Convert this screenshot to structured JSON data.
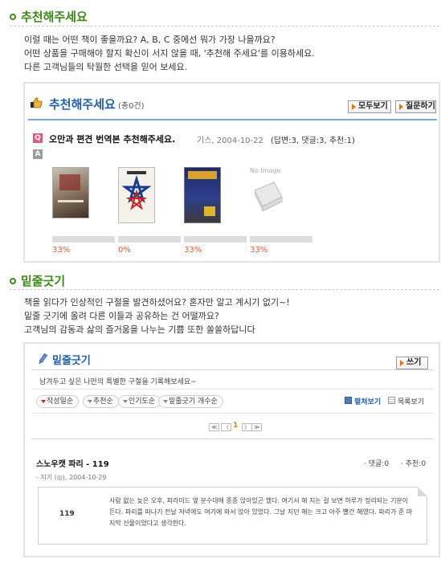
{
  "section1": {
    "title": "추천해주세요",
    "desc": [
      "이럴 때는 어떤 책이 좋을까요? A, B, C 중에선 뭐가 가장 나을까요?",
      "어떤 상품을 구매해야 할지 확신이 서지 않을 때, '추천해 주세요'를 이용하세요.",
      "다른 고객님들의 탁월한 선택을 믿어 보세요."
    ],
    "panel": {
      "title": "추천해주세요",
      "count": "(총0건)",
      "view_all_button": "모두보기",
      "ask_button": "질문하기",
      "q_tag": "Q",
      "a_tag": "A",
      "question_title": "오만과 편견 번역본 추천해주세요.",
      "question_meta": "기스, 2004-10-22",
      "question_stats": "(답변:3, 댓글:3, 추천:1)",
      "books": [
        {
          "cover": "book-cover-1",
          "percent": "33%"
        },
        {
          "cover": "book-cover-2",
          "percent": "0%"
        },
        {
          "cover": "book-cover-3",
          "percent": "33%"
        },
        {
          "cover": "no-image",
          "percent": "33%",
          "placeholder": "No Image"
        }
      ],
      "book_fill": [
        0.33,
        0.0,
        0.33,
        0.33
      ]
    }
  },
  "section2": {
    "title": "밑줄긋기",
    "desc": [
      "책을 읽다가 인상적인 구절을 발견하셨어요? 혼자만 알고 계시기 없기~!",
      "밑줄 긋기에 올려 다른 이들과 공유하는 건 어떨까요?",
      "고객님의 감동과  삶의 즐거움을 나누는 기쁨 또한 쏠쏠하답니다"
    ],
    "panel": {
      "title": "밑줄긋기",
      "write_button": "쓰기",
      "subtitle": "남겨두고 싶은 나만의 특별한 구절을 기록해보세요~",
      "sort_options": [
        "작성일순",
        "추천순",
        "인기도순",
        "밑줄긋기 개수순"
      ],
      "view_card": "펼쳐보기",
      "view_list": "목록보기",
      "pagination": {
        "first": "≪",
        "prev": "〈",
        "current": "1",
        "next": "〉",
        "last": "≫"
      },
      "entry": {
        "title": "스노우캣 파리 - 119",
        "comments": "· 댓글:0",
        "recommends": "· 추천:0",
        "meta": "- 지기 (◎), 2004-10-29",
        "page_no": "119",
        "quote": "사람 없는 늦은 오후, 피라미드 옆 분수대에 종종 앉아있곤 했다. 여기서 해 지는 걸 보면 하루가 정리되는 기분이 든다. 파리를 떠나기 전날 저녁에도 여기에 와서 앉아 있었다. 그날 지던 해는 크고 아주 빨간 해였다. 파리가 준 마지막 선물이었다고 생각한다."
      }
    }
  }
}
